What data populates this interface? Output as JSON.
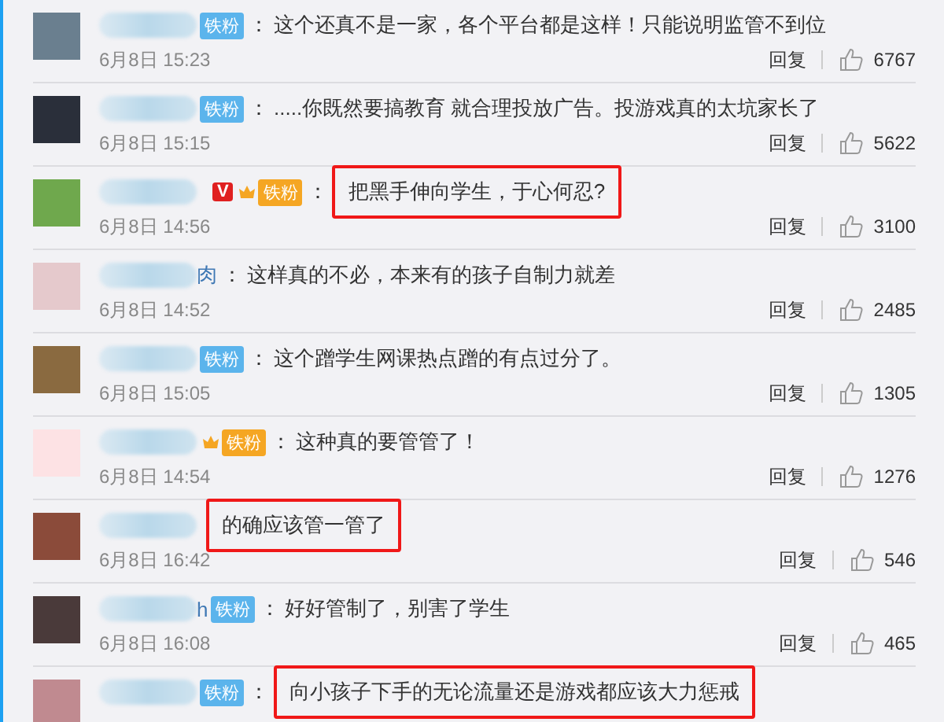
{
  "comments": [
    {
      "verified": false,
      "badge": {
        "kind": "fan",
        "label": "铁粉"
      },
      "colon": "：",
      "text": "这个还真不是一家，各个平台都是这样！只能说明监管不到位",
      "highlighted": false,
      "time": "6月8日 15:23",
      "reply": "回复",
      "likes": "6767"
    },
    {
      "verified": false,
      "badge": {
        "kind": "fan",
        "label": "铁粉"
      },
      "colon": "：",
      "text": ".....你既然要搞教育 就合理投放广告。投游戏真的太坑家长了",
      "highlighted": false,
      "time": "6月8日 15:15",
      "reply": "回复",
      "likes": "5622"
    },
    {
      "verified": true,
      "verified_label": "V",
      "badge": {
        "kind": "crown_fan",
        "label": "铁粉"
      },
      "colon": "：",
      "text": "把黑手伸向学生，于心何忍?",
      "highlighted": true,
      "time": "6月8日 14:56",
      "reply": "回复",
      "likes": "3100"
    },
    {
      "name_suffix": "肉",
      "verified": false,
      "colon": "：",
      "text": "这样真的不必，本来有的孩子自制力就差",
      "highlighted": false,
      "time": "6月8日 14:52",
      "reply": "回复",
      "likes": "2485"
    },
    {
      "verified": false,
      "badge": {
        "kind": "fan",
        "label": "铁粉"
      },
      "colon": "：",
      "text": "这个蹭学生网课热点蹭的有点过分了。",
      "highlighted": false,
      "time": "6月8日 15:05",
      "reply": "回复",
      "likes": "1305"
    },
    {
      "verified": false,
      "badge": {
        "kind": "crown_fan",
        "label": "铁粉"
      },
      "colon": "：",
      "text": "这种真的要管管了！",
      "highlighted": false,
      "time": "6月8日 14:54",
      "reply": "回复",
      "likes": "1276"
    },
    {
      "verified": false,
      "text": "的确应该管一管了",
      "highlighted": true,
      "time": "6月8日 16:42",
      "reply": "回复",
      "likes": "546"
    },
    {
      "name_suffix": "h",
      "verified": false,
      "badge": {
        "kind": "fan",
        "label": "铁粉"
      },
      "colon": "：",
      "text": "好好管制了，别害了学生",
      "highlighted": false,
      "time": "6月8日 16:08",
      "reply": "回复",
      "likes": "465"
    },
    {
      "verified": false,
      "badge": {
        "kind": "fan",
        "label": "铁粉"
      },
      "colon": "：",
      "text": "向小孩子下手的无论流量还是游戏都应该大力惩戒",
      "highlighted": true
    }
  ]
}
